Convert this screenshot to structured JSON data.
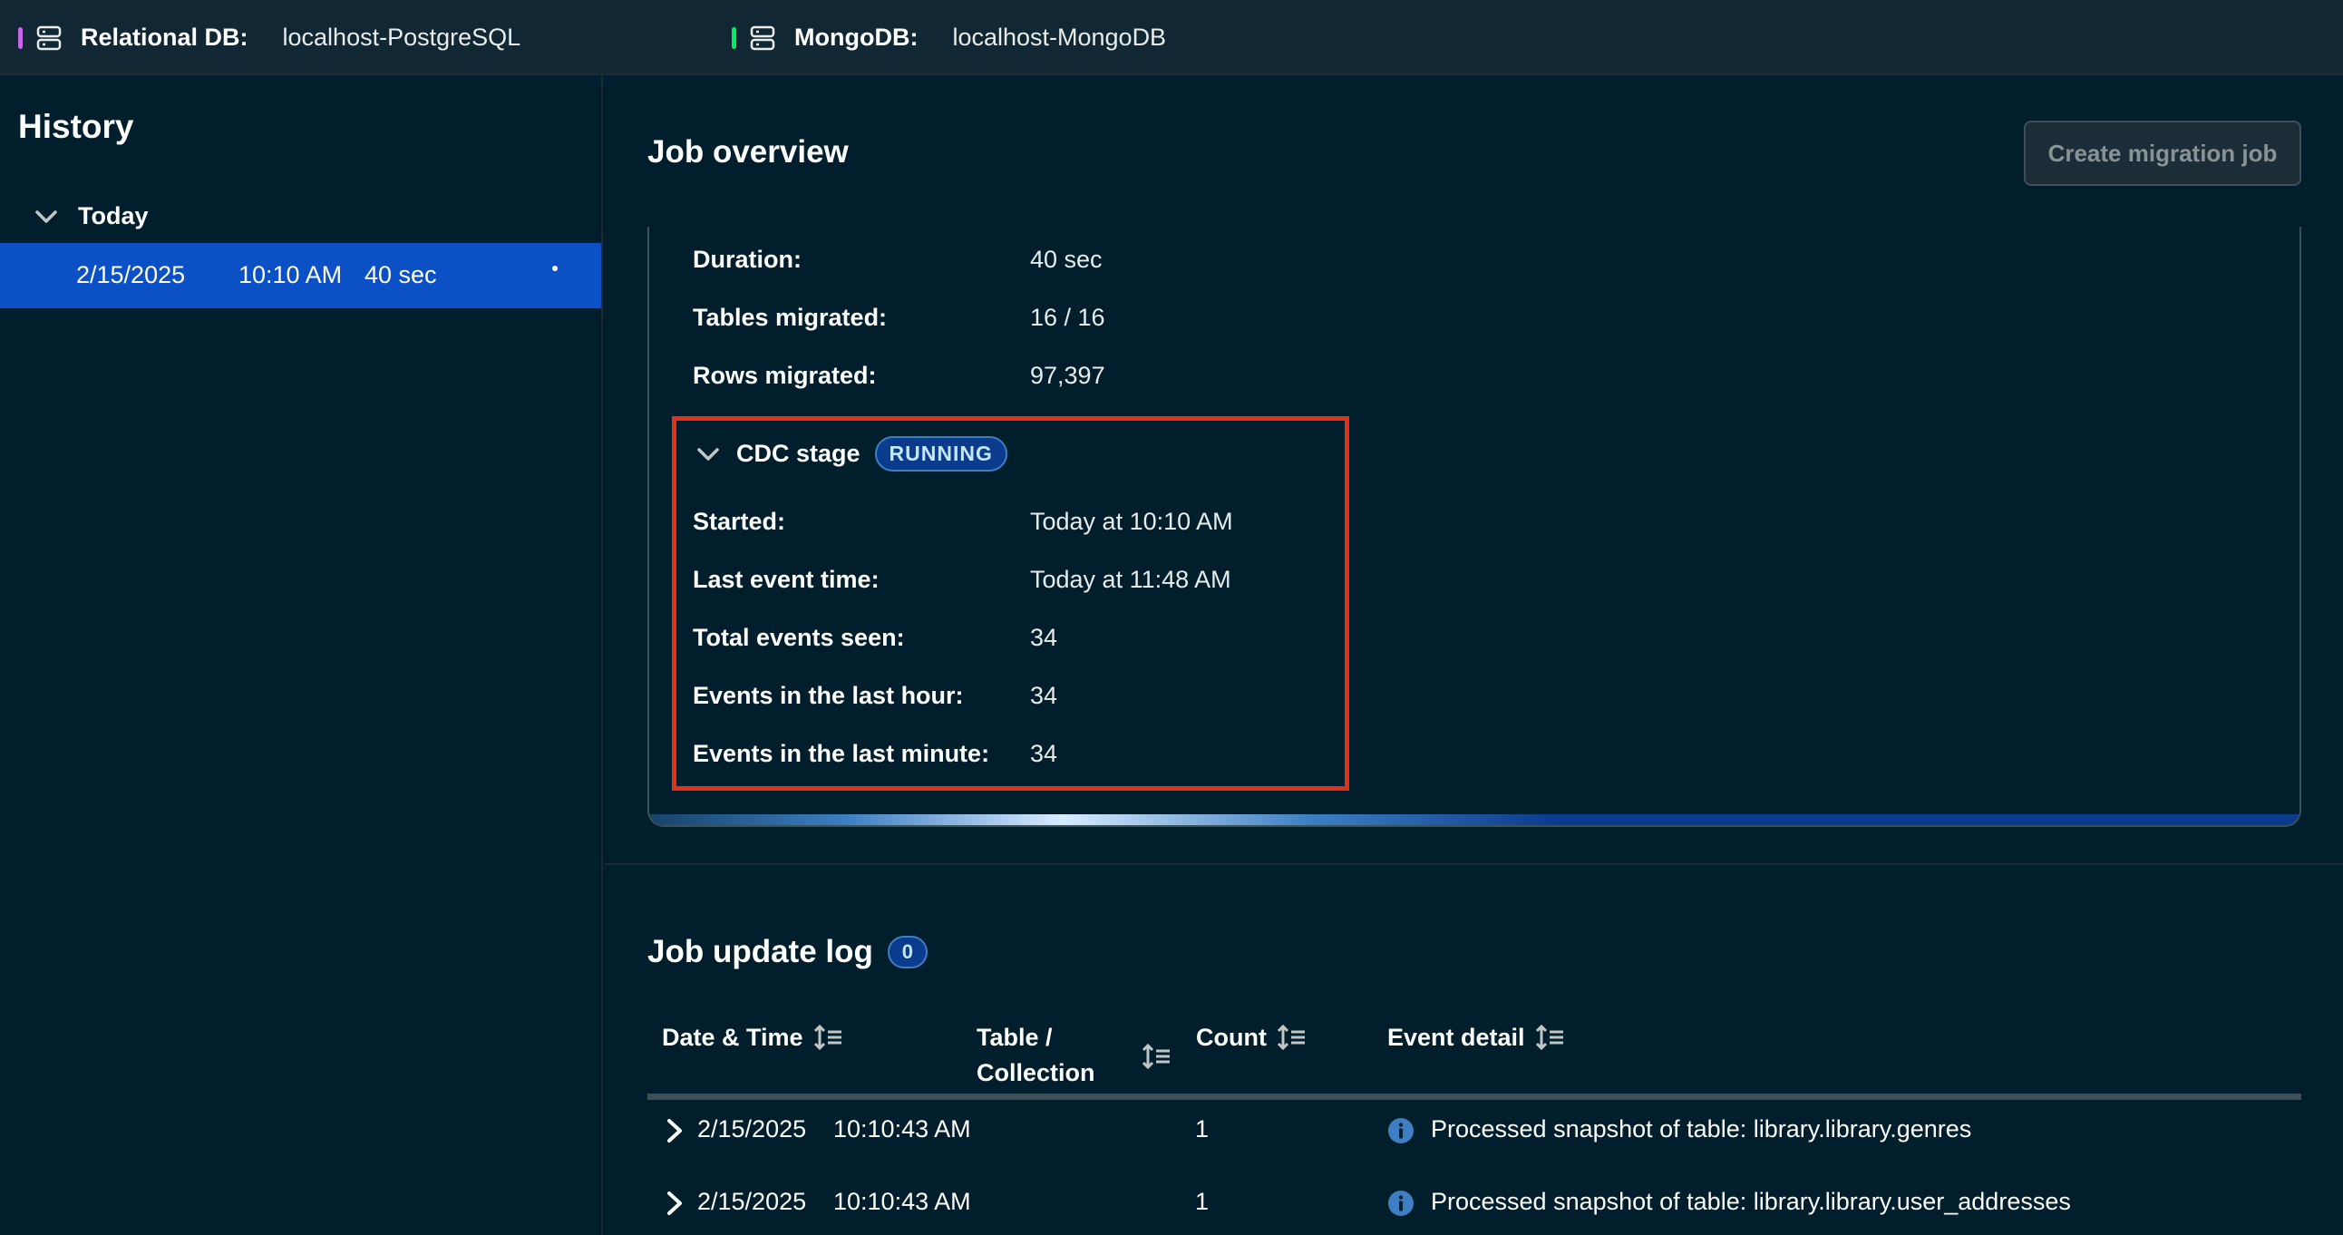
{
  "topbar": {
    "relational": {
      "label": "Relational DB:",
      "value": "localhost-PostgreSQL",
      "stripe_color": "#c566e8"
    },
    "mongo": {
      "label": "MongoDB:",
      "value": "localhost-MongoDB",
      "stripe_color": "#00ed64"
    }
  },
  "sidebar": {
    "title": "History",
    "group": "Today",
    "item": {
      "date": "2/15/2025",
      "time": "10:10 AM",
      "duration": "40 sec"
    }
  },
  "main": {
    "title": "Job overview",
    "create_button": "Create migration job",
    "stats": [
      {
        "label": "Duration:",
        "value": "40 sec"
      },
      {
        "label": "Tables migrated:",
        "value": "16 / 16"
      },
      {
        "label": "Rows migrated:",
        "value": "97,397"
      }
    ],
    "cdc": {
      "title": "CDC stage",
      "status": "RUNNING",
      "rows": [
        {
          "label": "Started:",
          "value": "Today at 10:10 AM"
        },
        {
          "label": "Last event time:",
          "value": "Today at 11:48 AM"
        },
        {
          "label": "Total events seen:",
          "value": "34"
        },
        {
          "label": "Events in the last hour:",
          "value": "34"
        },
        {
          "label": "Events in the last minute:",
          "value": "34"
        }
      ]
    },
    "log": {
      "title": "Job update log",
      "count": "0",
      "columns": {
        "datetime": "Date & Time",
        "table_line1": "Table /",
        "table_line2": "Collection",
        "count": "Count",
        "detail": "Event detail"
      },
      "rows": [
        {
          "date": "2/15/2025",
          "time": "10:10:43 AM",
          "count": "1",
          "detail": "Processed snapshot of table: library.library.genres"
        },
        {
          "date": "2/15/2025",
          "time": "10:10:43 AM",
          "count": "1",
          "detail": "Processed snapshot of table: library.library.user_addresses"
        }
      ]
    }
  }
}
